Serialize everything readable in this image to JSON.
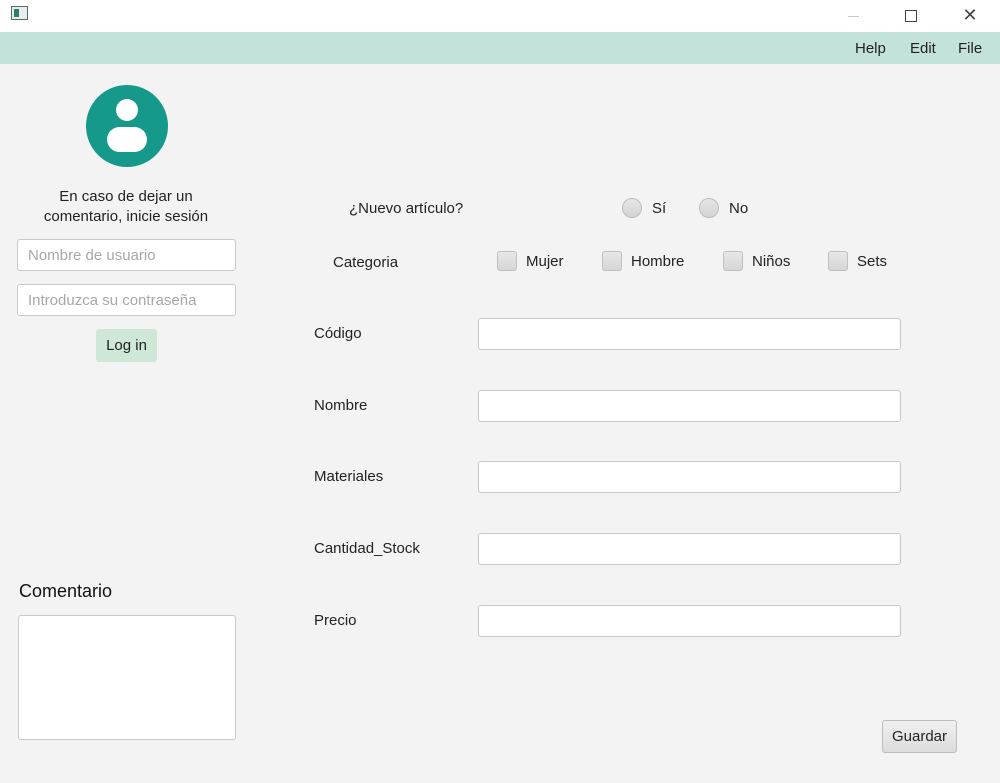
{
  "window": {
    "minimize_icon": "minimize-icon",
    "maximize_icon": "maximize-icon",
    "close_icon": "close-icon",
    "close_glyph": "✕"
  },
  "menubar": {
    "background": "#c2e2db",
    "items": [
      {
        "label": "Help"
      },
      {
        "label": "Edit"
      },
      {
        "label": "File"
      }
    ]
  },
  "login": {
    "avatar_icon": "user-avatar-icon",
    "avatar_color": "#14998a",
    "message": "En caso de dejar un comentario, inicie sesión",
    "username_placeholder": "Nombre de usuario",
    "username_value": "",
    "password_placeholder": "Introduzca su contraseña",
    "password_value": "",
    "button_label": "Log in",
    "button_color": "#cfe7d7"
  },
  "comment": {
    "label": "Comentario",
    "value": ""
  },
  "form": {
    "new_item_label": "¿Nuevo artículo?",
    "new_item_options": [
      {
        "label": "Sí",
        "selected": false
      },
      {
        "label": "No",
        "selected": false
      }
    ],
    "category_label": "Categoria",
    "categories": [
      {
        "label": "Mujer",
        "checked": false
      },
      {
        "label": "Hombre",
        "checked": false
      },
      {
        "label": "Niños",
        "checked": false
      },
      {
        "label": "Sets",
        "checked": false
      }
    ],
    "fields": [
      {
        "label": "Código",
        "value": ""
      },
      {
        "label": "Nombre",
        "value": ""
      },
      {
        "label": "Materiales",
        "value": ""
      },
      {
        "label": "Cantidad_Stock",
        "value": ""
      },
      {
        "label": "Precio",
        "value": ""
      }
    ],
    "save_label": "Guardar"
  }
}
